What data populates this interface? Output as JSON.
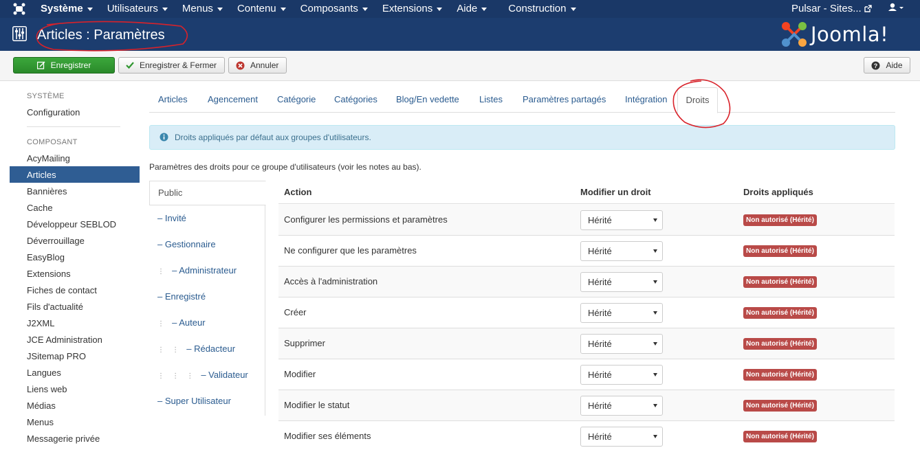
{
  "topnav": {
    "menu": [
      "Système",
      "Utilisateurs",
      "Menus",
      "Contenu",
      "Composants",
      "Extensions",
      "Aide",
      "Construction"
    ],
    "site_label": "Pulsar - Sites...",
    "site_icon": "external-link-icon",
    "user_icon": "user-icon"
  },
  "header": {
    "title": "Articles : Paramètres",
    "brand": "Joomla!"
  },
  "toolbar": {
    "save": "Enregistrer",
    "save_close": "Enregistrer & Fermer",
    "cancel": "Annuler",
    "help": "Aide"
  },
  "sidebar": {
    "system_heading": "SYSTÈME",
    "system_items": [
      "Configuration"
    ],
    "component_heading": "COMPOSANT",
    "component_items": [
      "AcyMailing",
      "Articles",
      "Bannières",
      "Cache",
      "Développeur SEBLOD",
      "Déverrouillage",
      "EasyBlog",
      "Extensions",
      "Fiches de contact",
      "Fils d'actualité",
      "J2XML",
      "JCE Administration",
      "JSitemap PRO",
      "Langues",
      "Liens web",
      "Médias",
      "Menus",
      "Messagerie privée"
    ],
    "active_item": "Articles"
  },
  "tabs": [
    "Articles",
    "Agencement",
    "Catégorie",
    "Catégories",
    "Blog/En vedette",
    "Listes",
    "Paramètres partagés",
    "Intégration",
    "Droits"
  ],
  "active_tab": "Droits",
  "info": "Droits appliqués par défaut aux groupes d'utilisateurs.",
  "perm_desc": "Paramètres des droits pour ce groupe d'utilisateurs (voir les notes au bas).",
  "groups": [
    "Public",
    "– Invité",
    "– Gestionnaire",
    "– Administrateur",
    "– Enregistré",
    "– Auteur",
    "– Rédacteur",
    "– Validateur",
    "– Super Utilisateur"
  ],
  "table": {
    "col_action": "Action",
    "col_modify": "Modifier un droit",
    "col_applied": "Droits appliqués",
    "rows": [
      {
        "action": "Configurer les permissions et paramètres",
        "select": "Hérité",
        "applied": "Non autorisé (Hérité)"
      },
      {
        "action": "Ne configurer que les paramètres",
        "select": "Hérité",
        "applied": "Non autorisé (Hérité)"
      },
      {
        "action": "Accès à l'administration",
        "select": "Hérité",
        "applied": "Non autorisé (Hérité)"
      },
      {
        "action": "Créer",
        "select": "Hérité",
        "applied": "Non autorisé (Hérité)"
      },
      {
        "action": "Supprimer",
        "select": "Hérité",
        "applied": "Non autorisé (Hérité)"
      },
      {
        "action": "Modifier",
        "select": "Hérité",
        "applied": "Non autorisé (Hérité)"
      },
      {
        "action": "Modifier le statut",
        "select": "Hérité",
        "applied": "Non autorisé (Hérité)"
      },
      {
        "action": "Modifier ses éléments",
        "select": "Hérité",
        "applied": "Non autorisé (Hérité)"
      }
    ]
  },
  "colors": {
    "nav": "#1a3867",
    "header": "#1c3d6f",
    "save_green": "#2f962f",
    "badge_red": "#b94a48",
    "annotation_red": "#d9222a"
  }
}
